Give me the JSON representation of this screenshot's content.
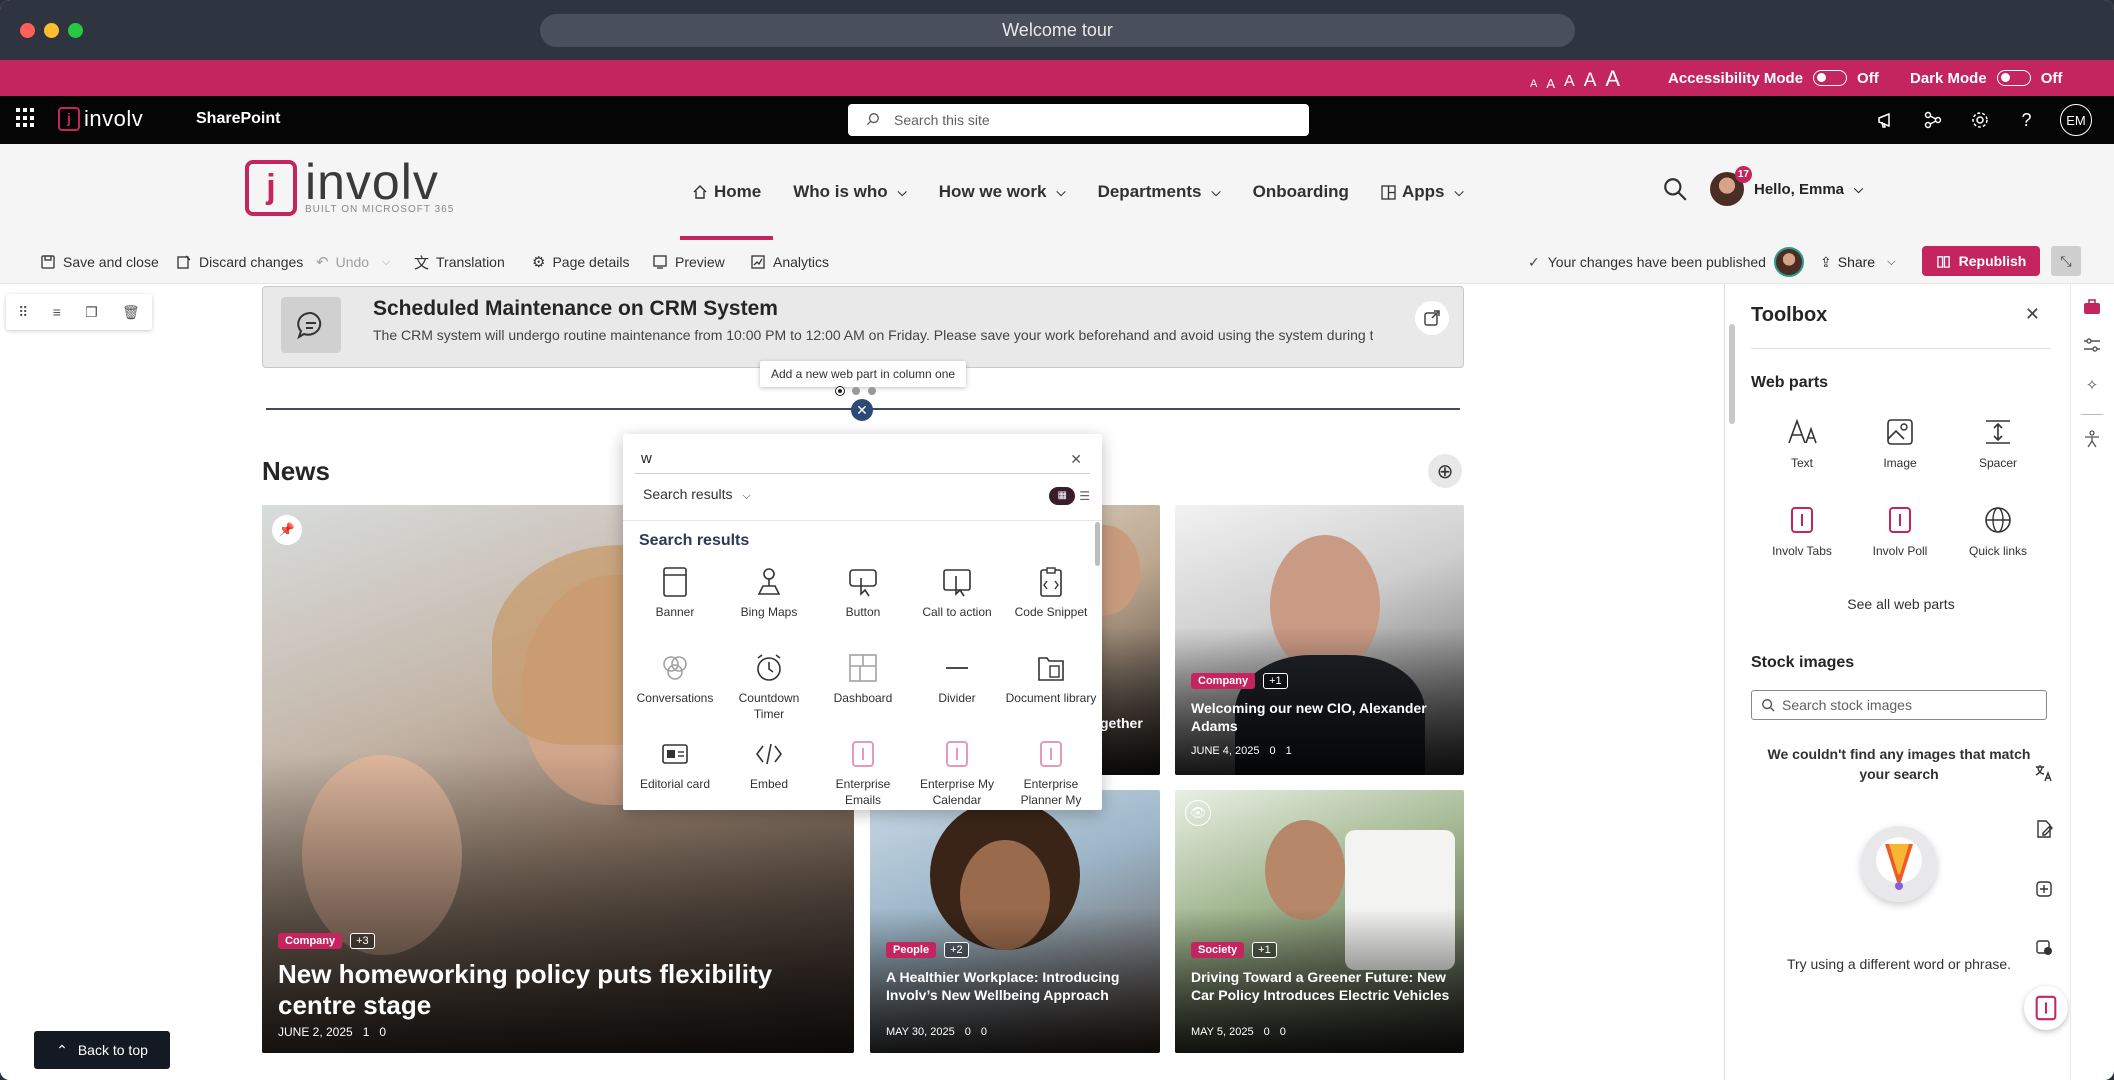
{
  "window": {
    "address": "Welcome tour",
    "dot_colors": [
      "#ff5f57",
      "#febc2e",
      "#28c840"
    ]
  },
  "accessibility_bar": {
    "text_sizes": [
      "A",
      "A",
      "A",
      "A",
      "A"
    ],
    "accessibility_label": "Accessibility Mode",
    "accessibility_state": "Off",
    "dark_label": "Dark Mode",
    "dark_state": "Off",
    "color": "#c4255e"
  },
  "suite_bar": {
    "logo_word": "involv",
    "logo_letter": "j",
    "app_name": "SharePoint",
    "search_placeholder": "Search this site",
    "icons": [
      "megaphone-icon",
      "share-network-icon",
      "settings-icon",
      "help-icon"
    ],
    "user_initials": "EM"
  },
  "site_header": {
    "logo_letter": "j",
    "logo_word": "involv",
    "logo_tagline": "BUILT ON MICROSOFT 365",
    "nav": [
      {
        "label": "Home",
        "active": true,
        "dropdown": false
      },
      {
        "label": "Who is who",
        "active": false,
        "dropdown": true
      },
      {
        "label": "How we work",
        "active": false,
        "dropdown": true
      },
      {
        "label": "Departments",
        "active": false,
        "dropdown": true
      },
      {
        "label": "Onboarding",
        "active": false,
        "dropdown": false
      },
      {
        "label": "Apps",
        "active": false,
        "dropdown": true
      }
    ],
    "notification_count": "17",
    "greeting": "Hello, Emma"
  },
  "command_bar": {
    "save_close": "Save and close",
    "discard": "Discard changes",
    "undo": "Undo",
    "translation": "Translation",
    "page_details": "Page details",
    "preview": "Preview",
    "analytics": "Analytics",
    "published_status": "Your changes have been published",
    "share": "Share",
    "republish": "Republish"
  },
  "alert": {
    "title": "Scheduled Maintenance on CRM System",
    "text": "The CRM system will undergo routine maintenance from 10:00 PM to 12:00 AM on Friday. Please save your work beforehand and avoid using the system during this ti..."
  },
  "tooltip": "Add a new web part in column one",
  "news": {
    "title": "News",
    "cards": [
      {
        "tag": "Company",
        "more": "+3",
        "title": "New homeworking policy puts flexibility centre stage",
        "date": "JUNE 2, 2025",
        "likes": "1",
        "comments": "0"
      },
      {
        "tag": "",
        "more": "",
        "title": "gether",
        "date": "",
        "likes": "",
        "comments": ""
      },
      {
        "tag": "Company",
        "more": "+1",
        "title": "Welcoming our new CIO, Alexander Adams",
        "date": "JUNE 4, 2025",
        "likes": "0",
        "comments": "1"
      },
      {
        "tag": "People",
        "more": "+2",
        "title": "A Healthier Workplace: Introducing Involv’s New Wellbeing Approach",
        "date": "MAY 30, 2025",
        "likes": "0",
        "comments": "0"
      },
      {
        "tag": "Society",
        "more": "+1",
        "title": "Driving Toward a Greener Future: New Car Policy Introduces Electric Vehicles",
        "date": "MAY 5, 2025",
        "likes": "0",
        "comments": "0"
      }
    ]
  },
  "picker": {
    "query": "w",
    "filter": "Search results",
    "heading": "Search results",
    "items": [
      {
        "label": "Banner",
        "icon": "banner-icon"
      },
      {
        "label": "Bing Maps",
        "icon": "map-pin-icon"
      },
      {
        "label": "Button",
        "icon": "button-click-icon"
      },
      {
        "label": "Call to action",
        "icon": "call-to-action-icon"
      },
      {
        "label": "Code Snippet",
        "icon": "code-snippet-icon"
      },
      {
        "label": "Conversations",
        "icon": "conversations-icon"
      },
      {
        "label": "Countdown Timer",
        "icon": "alarm-clock-icon"
      },
      {
        "label": "Dashboard",
        "icon": "dashboard-icon"
      },
      {
        "label": "Divider",
        "icon": "divider-icon"
      },
      {
        "label": "Document library",
        "icon": "document-library-icon"
      },
      {
        "label": "Editorial card",
        "icon": "editorial-card-icon"
      },
      {
        "label": "Embed",
        "icon": "embed-icon"
      },
      {
        "label": "Enterprise Emails",
        "icon": "involv-icon"
      },
      {
        "label": "Enterprise My Calendar",
        "icon": "involv-icon"
      },
      {
        "label": "Enterprise Planner My",
        "icon": "involv-icon"
      }
    ]
  },
  "toolbox": {
    "title": "Toolbox",
    "web_parts_heading": "Web parts",
    "web_parts": [
      {
        "label": "Text",
        "icon": "text-icon"
      },
      {
        "label": "Image",
        "icon": "image-icon"
      },
      {
        "label": "Spacer",
        "icon": "spacer-icon"
      },
      {
        "label": "Involv Tabs",
        "icon": "involv-icon"
      },
      {
        "label": "Involv Poll",
        "icon": "involv-icon"
      },
      {
        "label": "Quick links",
        "icon": "globe-icon"
      }
    ],
    "see_all": "See all web parts",
    "stock_heading": "Stock images",
    "stock_placeholder": "Search stock images",
    "empty_message": "We couldn't find any images that match your search",
    "hint": "Try using a different word or phrase."
  },
  "back_to_top": "Back to top"
}
